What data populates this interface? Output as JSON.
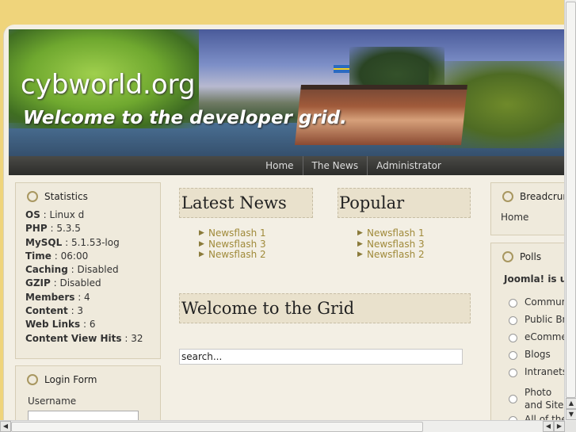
{
  "site": {
    "title": "cybworld.org",
    "tagline": "Welcome to the developer grid."
  },
  "nav": [
    "Home",
    "The News",
    "Administrator"
  ],
  "statistics": {
    "heading": "Statistics",
    "rows": [
      {
        "label": "OS",
        "value": "Linux d"
      },
      {
        "label": "PHP",
        "value": "5.3.5"
      },
      {
        "label": "MySQL",
        "value": "5.1.53-log"
      },
      {
        "label": "Time",
        "value": "06:00"
      },
      {
        "label": "Caching",
        "value": "Disabled"
      },
      {
        "label": "GZIP",
        "value": "Disabled"
      },
      {
        "label": "Members",
        "value": "4"
      },
      {
        "label": "Content",
        "value": "3"
      },
      {
        "label": "Web Links",
        "value": "6"
      },
      {
        "label": "Content View Hits",
        "value": "32"
      }
    ]
  },
  "login": {
    "heading": "Login Form",
    "username_label": "Username"
  },
  "latest_news": {
    "heading": "Latest News",
    "items": [
      "Newsflash 1",
      "Newsflash 3",
      "Newsflash 2"
    ]
  },
  "popular": {
    "heading": "Popular",
    "items": [
      "Newsflash 1",
      "Newsflash 3",
      "Newsflash 2"
    ]
  },
  "welcome": {
    "heading": "Welcome to the Grid"
  },
  "search": {
    "value": "search..."
  },
  "breadcrumbs": {
    "heading": "Breadcrumb",
    "current": "Home"
  },
  "polls": {
    "heading": "Polls",
    "question": "Joomla! is us",
    "options": [
      "Communit",
      "Public Bra",
      "eCommerc",
      "Blogs",
      "Intranets",
      "Photo and Sites",
      "All of the"
    ]
  },
  "colors": {
    "background": "#efd47b",
    "link": "#a08a3a",
    "nav_bar": "#2c2c2a"
  }
}
